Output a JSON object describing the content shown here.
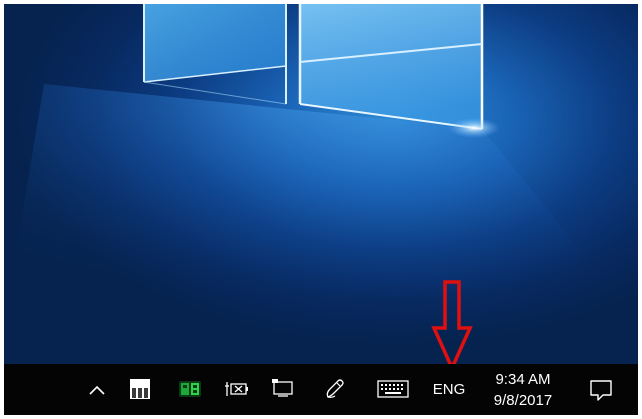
{
  "desktop": {
    "wallpaper_name": "Windows 10 hero wallpaper",
    "annotation_color": "#e01010"
  },
  "taskbar": {
    "background": "#040404",
    "icons": [
      "show-hidden-icons-chevron-icon",
      "meter-app-icon",
      "a9-app-icon",
      "battery-charging-icon",
      "network-icon",
      "pen-workspace-icon",
      "touch-keyboard-icon"
    ],
    "language": "ENG",
    "clock": {
      "time": "9:34 AM",
      "date": "9/8/2017"
    },
    "notifications_icon": "action-center-icon"
  }
}
